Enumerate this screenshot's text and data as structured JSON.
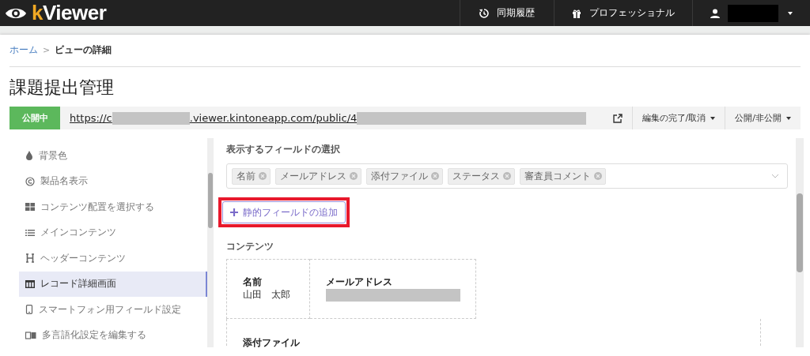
{
  "header": {
    "logo": "kViewer",
    "nav": [
      {
        "label": "同期履歴",
        "kind": "history"
      },
      {
        "label": "プロフェッショナル",
        "kind": "gift"
      },
      {
        "kind": "user"
      }
    ]
  },
  "breadcrumb": {
    "home": "ホーム",
    "separator": ">",
    "current": "ビューの詳細"
  },
  "title": "課題提出管理",
  "publish_bar": {
    "status": "公開中",
    "url_start": "https://c",
    "url_middle": ".viewer.kintoneapp.com/public/4",
    "buttons": [
      "編集の完了/取消",
      "公開/非公開"
    ]
  },
  "sidebar": {
    "items": [
      {
        "label": "背景色",
        "selected": false
      },
      {
        "label": "製品名表示",
        "selected": false
      },
      {
        "label": "コンテンツ配置を選択する",
        "selected": false
      },
      {
        "label": "メインコンテンツ",
        "selected": false
      },
      {
        "label": "ヘッダーコンテンツ",
        "selected": false
      },
      {
        "label": "レコード詳細画面",
        "selected": true
      },
      {
        "label": "スマートフォン用フィールド設定",
        "selected": false
      },
      {
        "label": "多言語化設定を編集する",
        "selected": false
      }
    ]
  },
  "main": {
    "field_select_label": "表示するフィールドの選択",
    "fields": [
      "名前",
      "メールアドレス",
      "添付ファイル",
      "ステータス",
      "審査員コメント"
    ],
    "add_button": {
      "label": "静的フィールドの追加",
      "highlighted": true
    },
    "contents_label": "コンテンツ",
    "layout_cells": [
      {
        "label": "名前",
        "value": "山田　太郎"
      },
      {
        "label": "メールアドレス",
        "redacted": true
      },
      {
        "label": "添付ファイル",
        "wide": true
      }
    ]
  }
}
